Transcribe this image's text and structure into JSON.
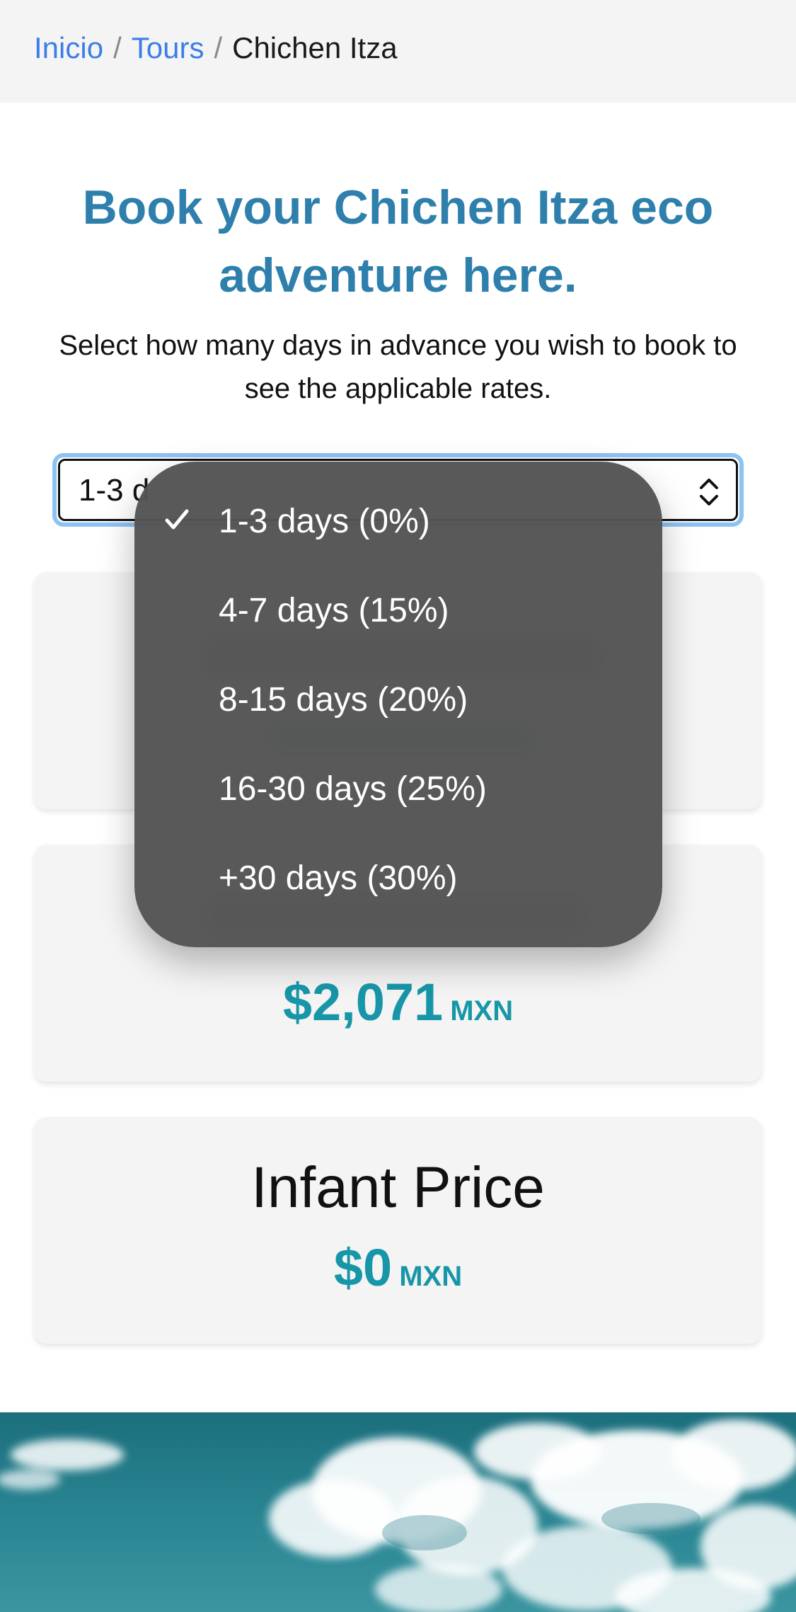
{
  "breadcrumb": {
    "items": [
      {
        "label": "Inicio"
      },
      {
        "label": "Tours"
      }
    ],
    "separator": "/",
    "current": "Chichen Itza"
  },
  "headline": "Book your Chichen Itza eco adventure here.",
  "subtitle": "Select how many days in advance you wish to book to see the applicable rates.",
  "rate_select": {
    "selected_value": "1-3 d",
    "options": [
      {
        "label": "1-3 days (0%)",
        "selected": true
      },
      {
        "label": "4-7 days (15%)",
        "selected": false
      },
      {
        "label": "8-15 days (20%)",
        "selected": false
      },
      {
        "label": "16-30 days (25%)",
        "selected": false
      },
      {
        "label": "+30 days (30%)",
        "selected": false
      }
    ]
  },
  "cards": [
    {
      "title": "",
      "amount": "",
      "currency": ""
    },
    {
      "title": "",
      "amount": "$2,071",
      "currency": "MXN"
    },
    {
      "title": "Infant Price",
      "amount": "$0",
      "currency": "MXN"
    }
  ],
  "colors": {
    "link": "#3b7ee8",
    "headline": "#2e7fac",
    "price": "#1796a8",
    "card_bg": "#f4f4f4",
    "dropdown_bg": "#545454",
    "focus_ring": "#8dc3f3"
  },
  "icons": {
    "select_chevron": "chevron-up-down-icon",
    "checkmark": "checkmark-icon"
  }
}
